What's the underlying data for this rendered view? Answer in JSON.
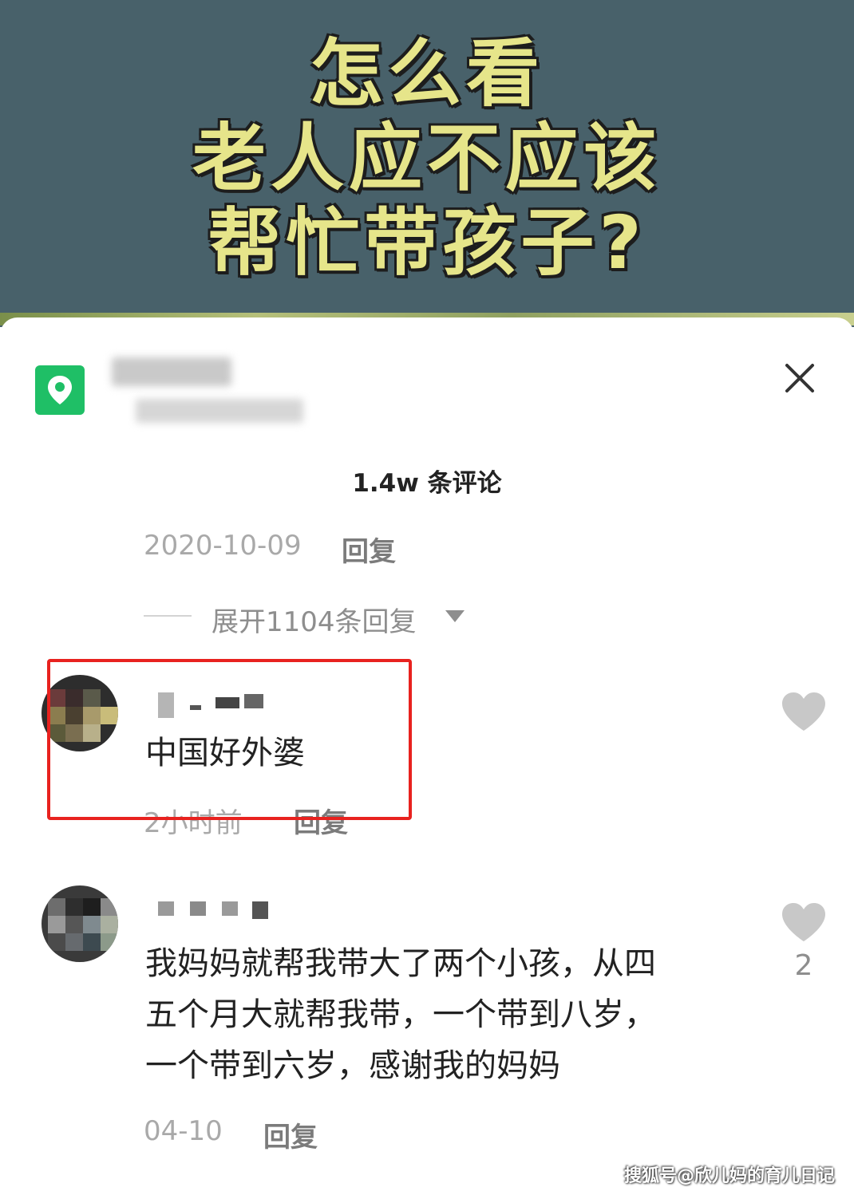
{
  "banner": {
    "title_lines": [
      "怎么看",
      "老人应不应该",
      "帮忙带孩子?"
    ]
  },
  "header": {
    "location_icon": "location-pin-icon",
    "close_icon": "close-icon"
  },
  "comments_header": {
    "count_label": "1.4w 条评论"
  },
  "parent_comment": {
    "date": "2020-10-09",
    "reply_label": "回复",
    "expand_label": "展开1104条回复"
  },
  "comments": [
    {
      "text": "中国好外婆",
      "time": "2小时前",
      "reply_label": "回复",
      "like_count": ""
    },
    {
      "text": "我妈妈就帮我带大了两个小孩，从四五个月大就帮我带，一个带到八岁，一个带到六岁，感谢我的妈妈",
      "line1": "我妈妈就帮我带大了两个小孩，从四",
      "line2": "五个月大就帮我带，一个带到八岁，",
      "line3": "一个带到六岁，感谢我的妈妈",
      "time": "04-10",
      "reply_label": "回复",
      "like_count": "2"
    }
  ],
  "colors": {
    "banner_bg": "#48616a",
    "banner_text": "#e6e58a",
    "location_green": "#1fbf66",
    "highlight_red": "#e8221f"
  },
  "watermark": "搜狐号@欣儿妈的育儿日记"
}
